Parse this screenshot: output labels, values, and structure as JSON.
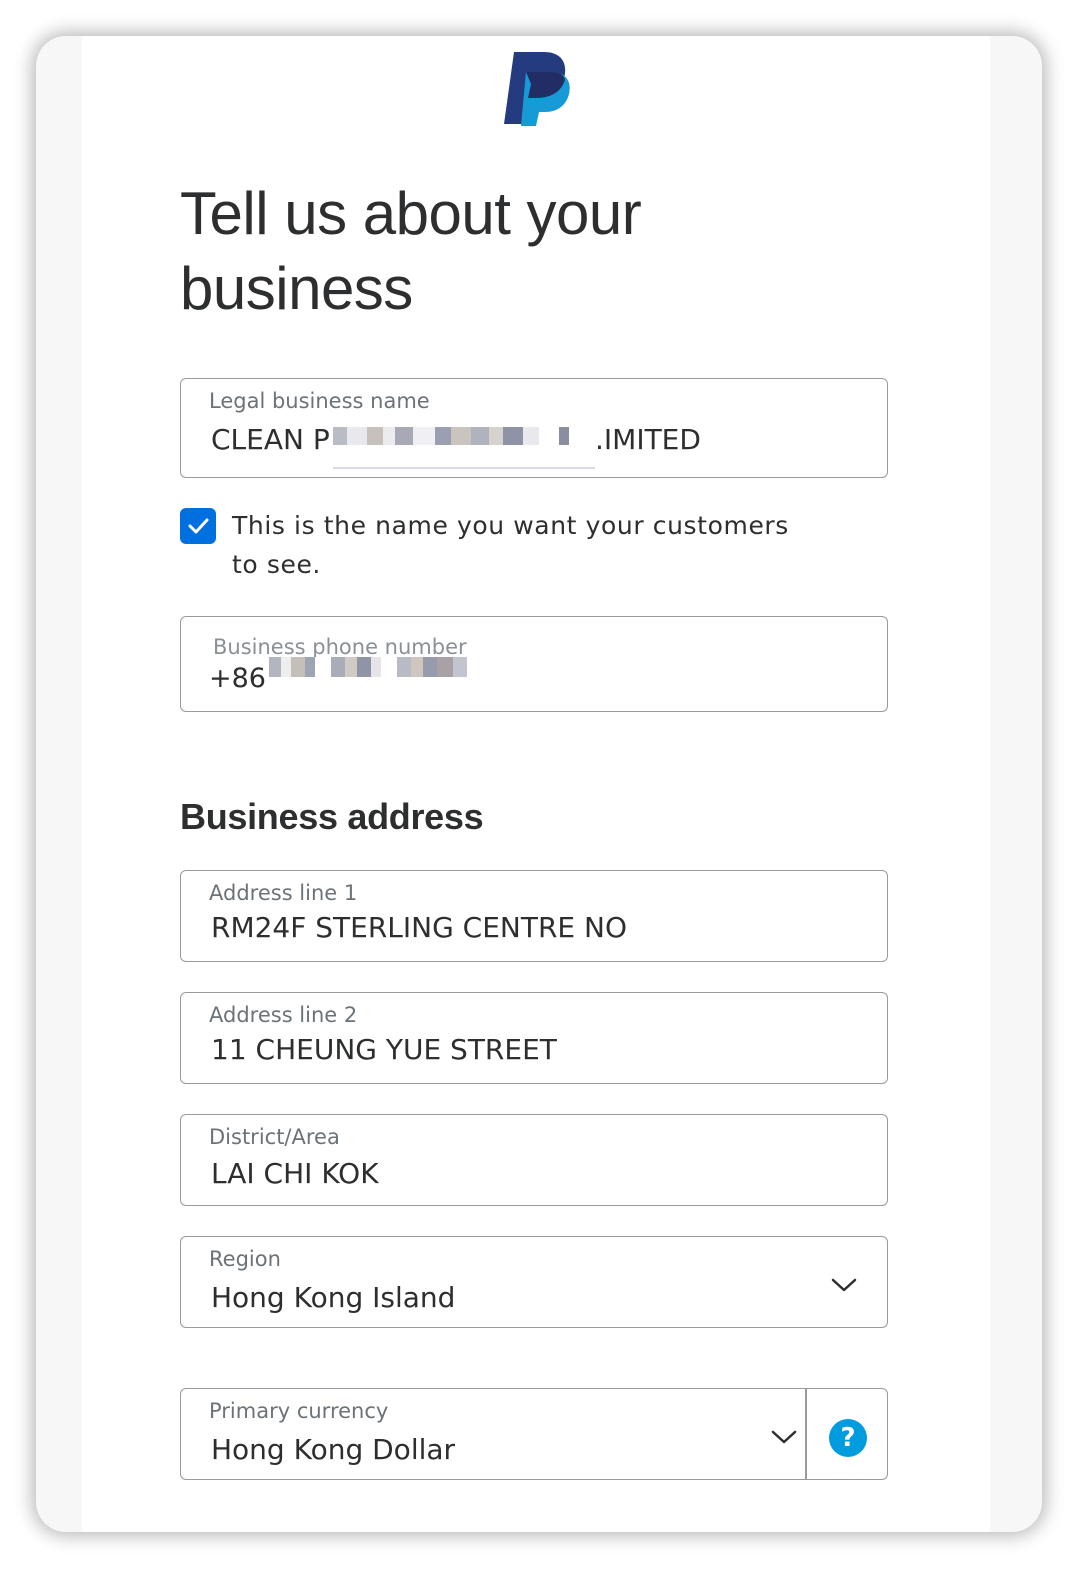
{
  "title": "Tell us about your business",
  "logo": {
    "icon": "paypal-logo-icon",
    "colors": [
      "#253b80",
      "#179bd7",
      "#222d65"
    ]
  },
  "legal_name": {
    "label": "Legal business name",
    "value_start": "CLEAN P",
    "value_end": ".IMITED"
  },
  "display_name_checkbox": {
    "checked": true,
    "label": "This is the name you want your customers to see."
  },
  "phone": {
    "label": "Business phone number",
    "prefix": "+86"
  },
  "address_section": {
    "title": "Business address"
  },
  "address_line1": {
    "label": "Address line 1",
    "value": "RM24F STERLING CENTRE NO"
  },
  "address_line2": {
    "label": "Address line 2",
    "value": "11 CHEUNG YUE STREET"
  },
  "district": {
    "label": "District/Area",
    "value": "LAI CHI KOK"
  },
  "region": {
    "label": "Region",
    "value": "Hong Kong Island"
  },
  "currency": {
    "label": "Primary currency",
    "value": "Hong Kong Dollar",
    "help_icon_text": "?"
  },
  "colors": {
    "accent": "#0070e0",
    "help": "#009cde",
    "border": "#9a9a9a"
  }
}
